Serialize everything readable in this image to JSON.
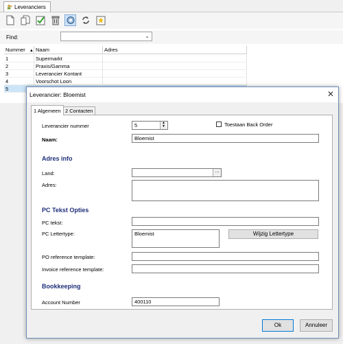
{
  "main": {
    "tab_label": "Leveranciers",
    "find_label": "Find:",
    "find_value": "",
    "columns": [
      "Nummer",
      "Naam",
      "Adres"
    ],
    "rows": [
      {
        "nummer": "1",
        "naam": "Supermarkt",
        "adres": ""
      },
      {
        "nummer": "2",
        "naam": "Praxis/Gamma",
        "adres": ""
      },
      {
        "nummer": "3",
        "naam": "Leverancier Kontant",
        "adres": ""
      },
      {
        "nummer": "4",
        "naam": "Voorschot Loon",
        "adres": ""
      },
      {
        "nummer": "5",
        "naam": "",
        "adres": ""
      }
    ],
    "toolbar_icons": [
      "new-doc-icon",
      "copy-doc-icon",
      "check-icon",
      "delete-bin-icon",
      "refresh-icon",
      "sync-icon",
      "favorite-icon"
    ]
  },
  "dialog": {
    "title": "Leverancier: Bloemist",
    "tabs": [
      "1 Algemeen",
      "2 Contacten"
    ],
    "fields": {
      "nummer_label": "Leverancier nummer",
      "nummer_value": "5",
      "backorder_label": "Toestaan Back Order",
      "naam_label": "Naam:",
      "naam_value": "Bloemist"
    },
    "adres_section": "Adres info",
    "land_label": "Land:",
    "land_value": "",
    "adres_label": "Adres:",
    "adres_value": "",
    "pc_section": "PC Tekst Opties",
    "pc_tekst_label": "PC tekst:",
    "pc_tekst_value": "",
    "pc_lettertype_label": "PC Lettertype:",
    "pc_lettertype_value": "Bloemist",
    "wijzig_button": "Wijzig Lettertype",
    "po_label": "PO reference template:",
    "po_value": "",
    "invoice_label": "Invoice reference template:",
    "invoice_value": "",
    "bookkeeping_section": "Bookkeeping",
    "account_label": "Account Number",
    "account_value": "400110",
    "ok_button": "Ok",
    "cancel_button": "Annuleer",
    "ellipsis": "..."
  },
  "colors": {
    "section": "#1f2f7a",
    "selection": "#cce4f7",
    "dialog_border": "#6d8fb8"
  }
}
